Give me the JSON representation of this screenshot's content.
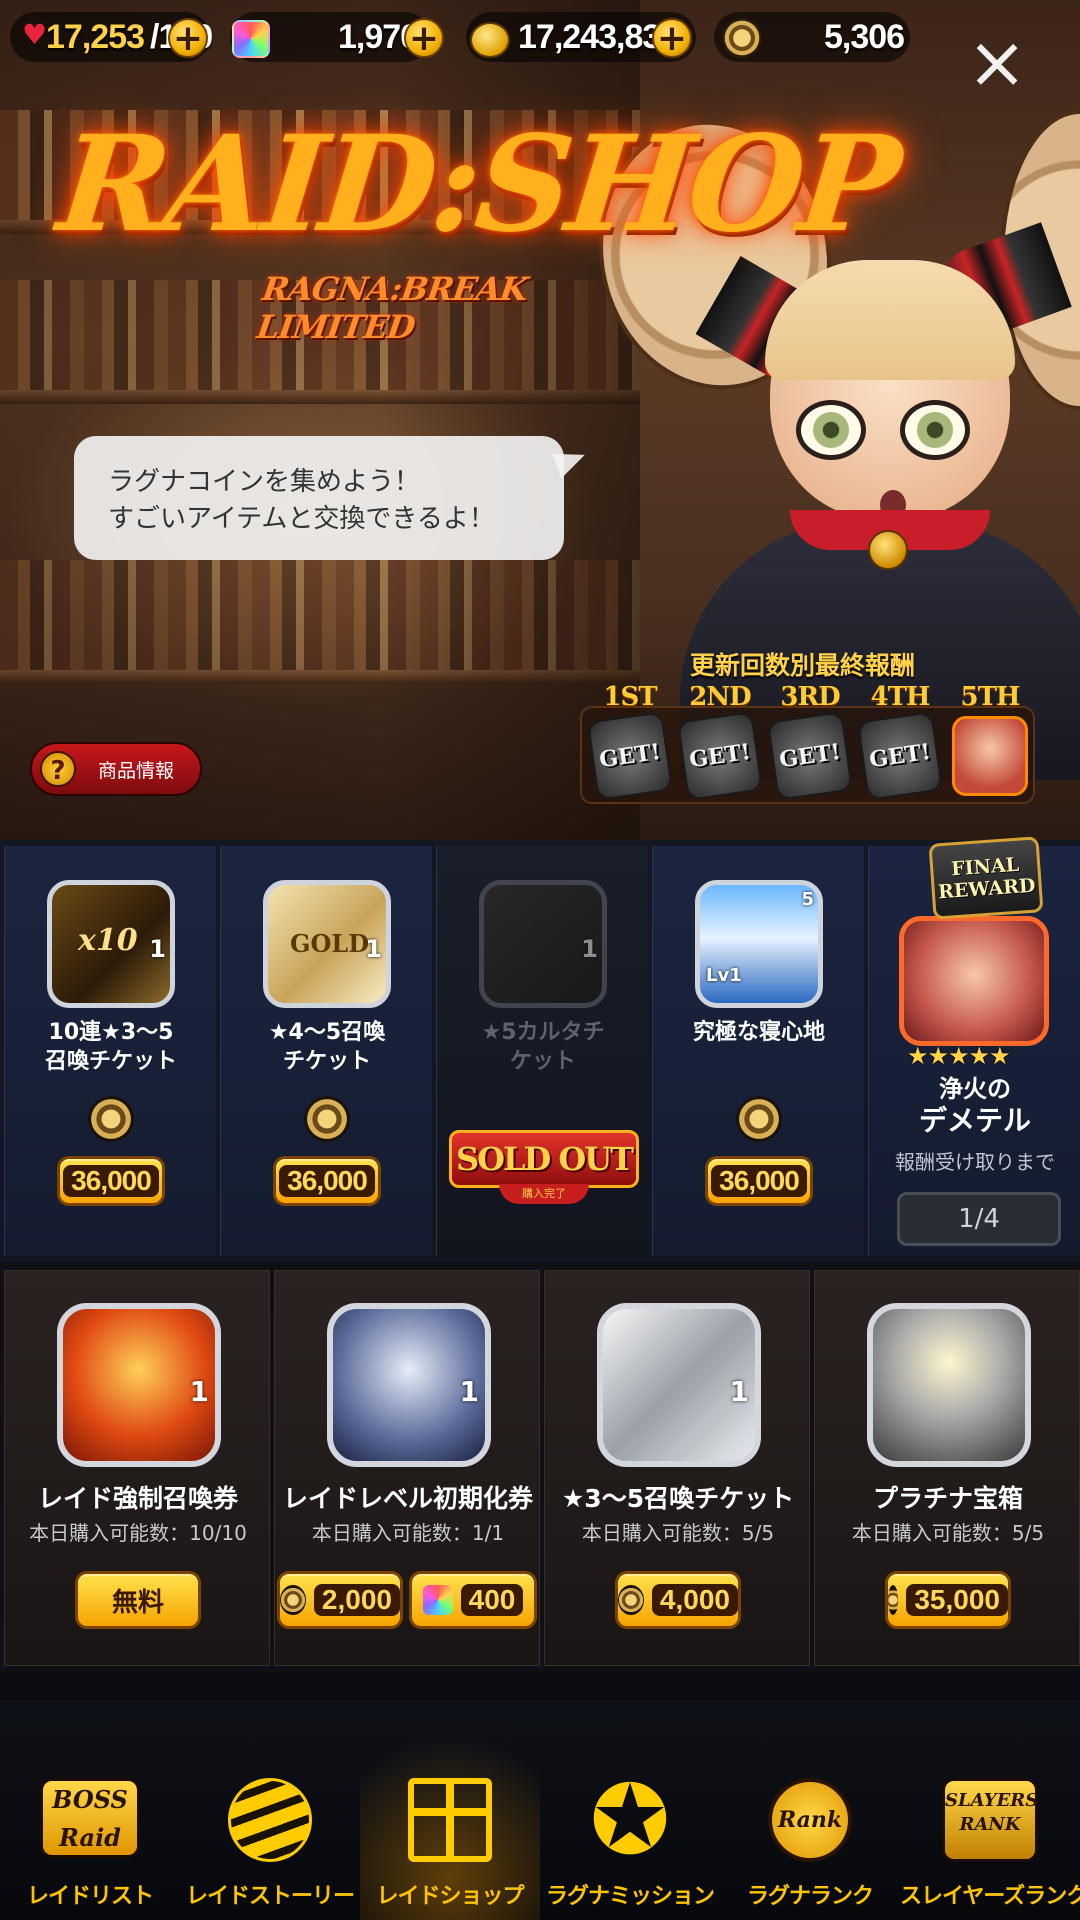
{
  "currencies": {
    "stamina": "17,253",
    "stamina_max": "/120",
    "gems": "1,970",
    "gold": "17,243,832",
    "ragna_coins": "5,306"
  },
  "hero": {
    "title": "RAID:SHOP",
    "subtitle": "RAGNA:BREAK LIMITED",
    "speech_line1": "ラグナコインを集めよう！",
    "speech_line2": "すごいアイテムと交換できるよ！",
    "info_button": "商品情報"
  },
  "milestone": {
    "header": "更新回数別最終報酬",
    "items": [
      {
        "ordinal": "1ST",
        "label": "GET!"
      },
      {
        "ordinal": "2ND",
        "label": "GET!"
      },
      {
        "ordinal": "3RD",
        "label": "GET!"
      },
      {
        "ordinal": "4TH",
        "label": "GET!"
      },
      {
        "ordinal": "5TH",
        "label": ""
      }
    ]
  },
  "limited_items": [
    {
      "name_line1": "10連★3～5",
      "name_line2": "召喚チケット",
      "price": "36,000",
      "count": "1",
      "icon": "x10-card-icon",
      "icon_text": "x10"
    },
    {
      "name_line1": "★4～5召喚",
      "name_line2": "チケット",
      "price": "36,000",
      "count": "1",
      "icon": "gold-card-icon",
      "icon_text": "GOLD"
    },
    {
      "name_line1": "★5カルタチ",
      "name_line2": "ケット",
      "sold_out": "SOLD OUT",
      "sold_sub": "購入完了",
      "count": "1",
      "icon": "karuta-ticket-icon"
    },
    {
      "name_line1": "究極な寝心地",
      "name_line2": "",
      "price": "36,000",
      "count": "5",
      "level": "Lv1",
      "icon": "bed-icon"
    }
  ],
  "final_reward": {
    "banner_line1": "FINAL",
    "banner_line2": "REWARD",
    "stars": "★★★★★",
    "name_line1": "浄火の",
    "name_line2": "デメテル",
    "until_label": "報酬受け取りまで",
    "progress": "1/4",
    "progress_fraction": 0.25
  },
  "daily_items": [
    {
      "name": "レイド強制召喚券",
      "limit": "本日購入可能数：10/10",
      "price_label": "無料",
      "count": "1",
      "icon": "summon-ticket-icon"
    },
    {
      "name": "レイドレベル初期化券",
      "limit": "本日購入可能数：1/1",
      "price_coins": "2,000",
      "price_gems": "400",
      "count": "1",
      "icon": "reset-ticket-icon"
    },
    {
      "name": "★3～5召喚チケット",
      "limit": "本日購入可能数：5/5",
      "price": "4,000",
      "count": "1",
      "icon": "platinum-card-icon"
    },
    {
      "name": "プラチナ宝箱",
      "limit": "本日購入可能数：5/5",
      "price": "35,000",
      "icon": "platinum-chest-icon"
    }
  ],
  "nav": [
    {
      "label": "レイドリスト",
      "icon_text": "BOSS Raid"
    },
    {
      "label": "レイドストーリー"
    },
    {
      "label": "レイドショップ",
      "active": true
    },
    {
      "label": "ラグナミッション"
    },
    {
      "label": "ラグナランク",
      "icon_text": "Rank"
    },
    {
      "label": "スレイヤーズランク",
      "icon_text": "SLAYERS RANK"
    }
  ],
  "colors": {
    "accent_gold": "#ffc400",
    "price_button": "#f7a300",
    "sold_out_red": "#c81e1e",
    "final_border": "#ff6a2a"
  }
}
